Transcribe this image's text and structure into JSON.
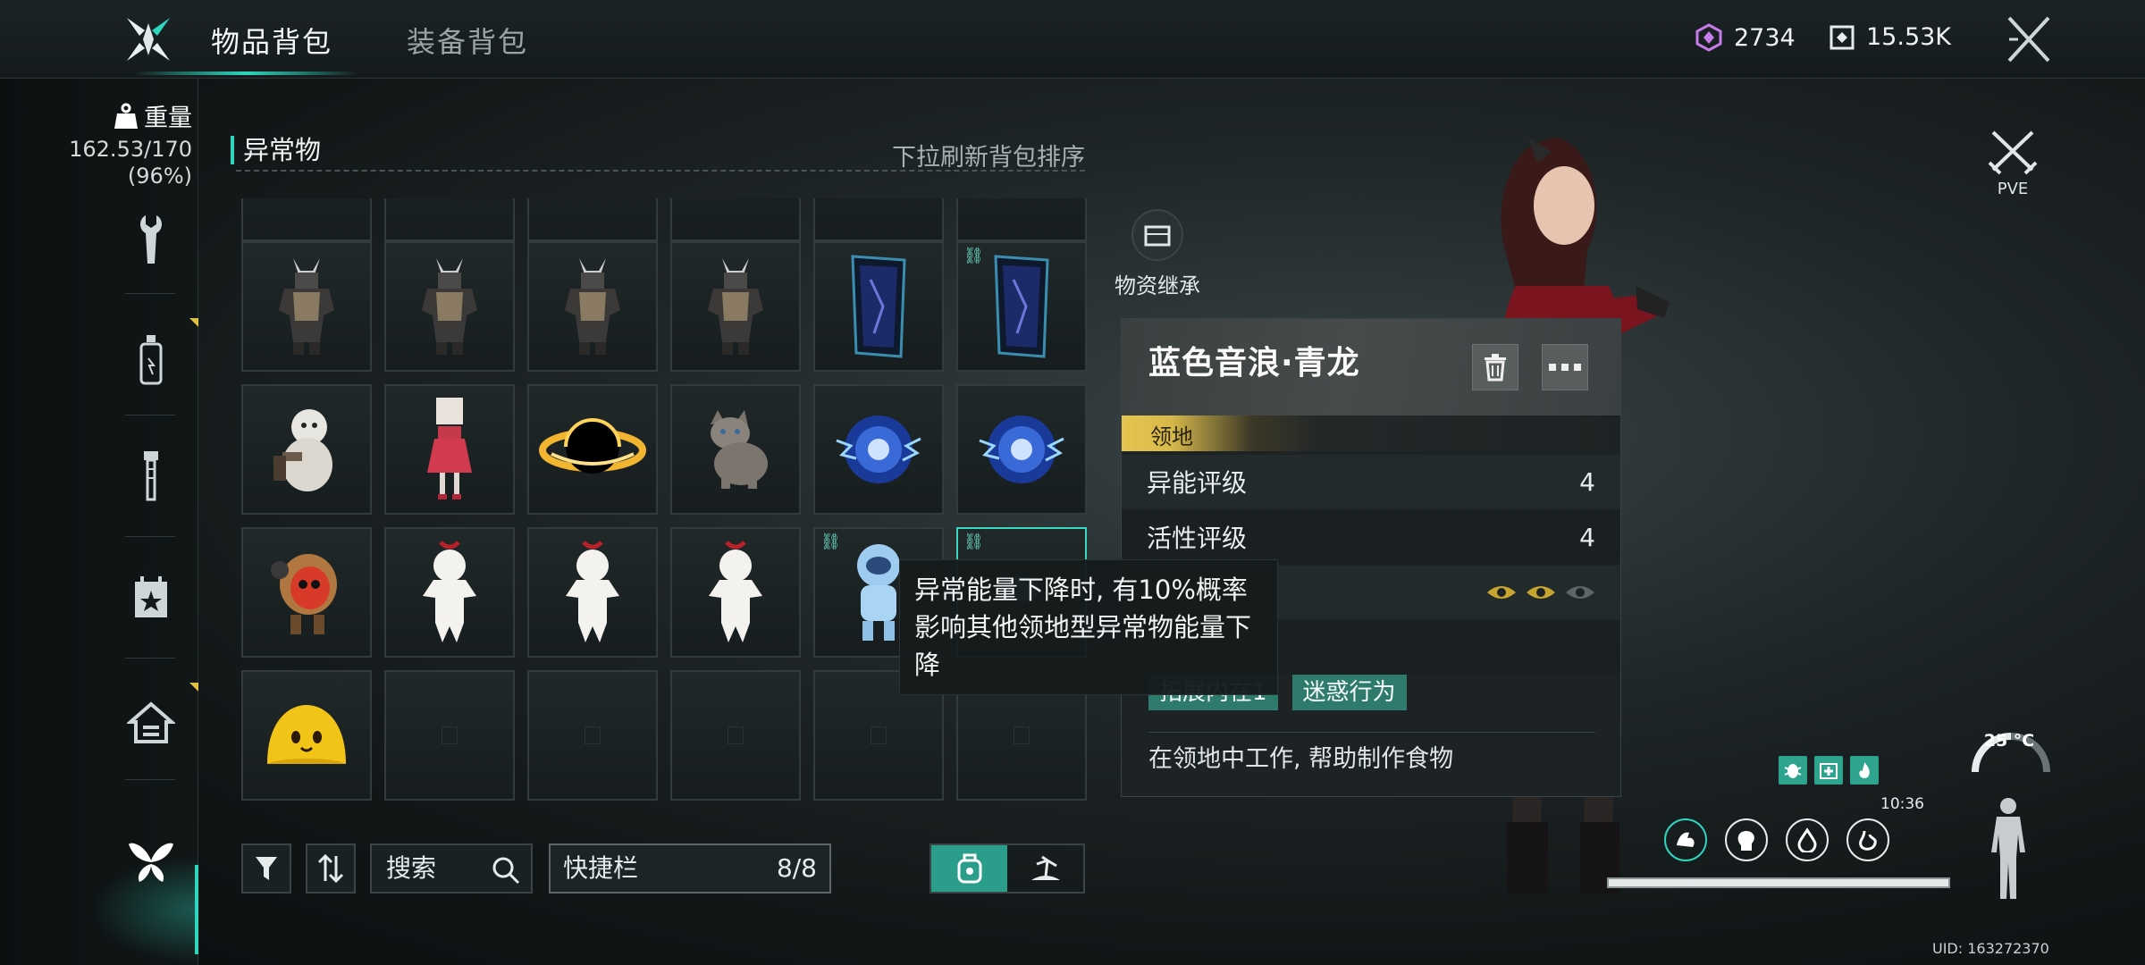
{
  "header": {
    "tabs": [
      {
        "label": "物品背包",
        "active": true
      },
      {
        "label": "装备背包",
        "active": false
      }
    ],
    "currencies": [
      {
        "icon": "crystal-currency-icon",
        "value": "2734"
      },
      {
        "icon": "token-currency-icon",
        "value": "15.53K"
      }
    ],
    "close_icon": "close-icon"
  },
  "sidebar": {
    "weight_label": "重量",
    "weight_value": "162.53/170",
    "weight_percent": "(96%)",
    "items": [
      {
        "icon": "wrench-icon",
        "name": "tools"
      },
      {
        "icon": "bottle-icon",
        "name": "consumables"
      },
      {
        "icon": "bolt-icon",
        "name": "materials"
      },
      {
        "icon": "calendar-star-icon",
        "name": "events"
      },
      {
        "icon": "house-icon",
        "name": "housing"
      },
      {
        "icon": "butterfly-icon",
        "name": "anomalies",
        "active": true
      }
    ]
  },
  "inventory": {
    "category_title": "异常物",
    "hint": "下拉刷新背包排序",
    "quickbar_label": "快捷栏",
    "quickbar_count": "8/8",
    "search_placeholder": "搜索",
    "rows": [
      [
        "partial",
        "partial",
        "partial",
        "partial",
        "partial",
        "partial"
      ],
      [
        "samurai",
        "samurai",
        "samurai",
        "samurai",
        "dark-door",
        "dark-door-linked"
      ],
      [
        "snowman",
        "red-doll",
        "black-hole",
        "cat",
        "blue-orb",
        "blue-orb"
      ],
      [
        "hooded-creature",
        "paper-doll",
        "paper-doll",
        "paper-doll",
        "astronaut-linked",
        "selected-linked"
      ],
      [
        "yellow-blob",
        "empty",
        "empty",
        "empty",
        "empty",
        "empty"
      ]
    ]
  },
  "inherit": {
    "label": "物资继承"
  },
  "detail": {
    "title": "蓝色音浪·青龙",
    "type_tag": "领地",
    "stats": [
      {
        "label": "异能评级",
        "value": "4"
      },
      {
        "label": "活性评级",
        "value": "4"
      }
    ],
    "tags": [
      "拓展内在1",
      "迷惑行为"
    ],
    "description": "在领地中工作, 帮助制作食物"
  },
  "tooltip": {
    "text": "异常能量下降时, 有10%概率影响其他领地型异常物能量下降"
  },
  "hud": {
    "mode": "PVE",
    "temperature": "25 °C",
    "clock": "10:36",
    "uid": "UID: 163272370",
    "stamina_fraction": 1.0
  },
  "colors": {
    "accent": "#2ed6be",
    "gold": "#e6c650",
    "tag_green": "#2e7a6d"
  }
}
